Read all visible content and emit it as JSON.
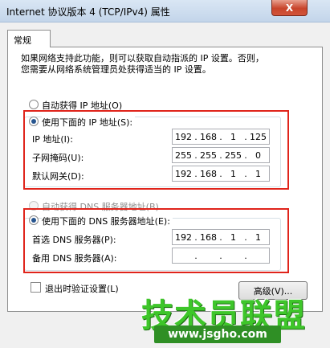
{
  "window": {
    "title": "Internet 协议版本 4 (TCP/IPv4) 属性",
    "close_glyph": "X"
  },
  "tabs": [
    {
      "label": "常规"
    }
  ],
  "description": {
    "line1": "如果网络支持此功能，则可以获取自动指派的 IP 设置。否则，",
    "line2": "您需要从网络系统管理员处获得适当的 IP 设置。"
  },
  "ip_section": {
    "auto_label": "自动获得 IP 地址(O)",
    "manual_label": "使用下面的 IP 地址(S):",
    "selected": "manual",
    "fields": [
      {
        "label": "IP 地址(I):",
        "octets": [
          "192",
          "168",
          "1",
          "125"
        ]
      },
      {
        "label": "子网掩码(U):",
        "octets": [
          "255",
          "255",
          "255",
          "0"
        ]
      },
      {
        "label": "默认网关(D):",
        "octets": [
          "192",
          "168",
          "1",
          "1"
        ]
      }
    ]
  },
  "dns_section": {
    "auto_label": "自动获得 DNS 服务器地址(B)",
    "manual_label": "使用下面的 DNS 服务器地址(E):",
    "selected": "manual",
    "fields": [
      {
        "label": "首选 DNS 服务器(P):",
        "octets": [
          "192",
          "168",
          "1",
          "1"
        ]
      },
      {
        "label": "备用 DNS 服务器(A):",
        "octets": [
          "",
          "",
          "",
          ""
        ]
      }
    ]
  },
  "footer": {
    "validate_label": "退出时验证设置(L)",
    "validate_checked": false,
    "advanced_button": "高级(V)..."
  },
  "watermark": {
    "text": "技术员联盟",
    "url": "www.jsgho.com"
  },
  "colors": {
    "annotation_red": "#e0241b",
    "radio_dot": "#27558f",
    "watermark_green": "#3ec62a"
  }
}
